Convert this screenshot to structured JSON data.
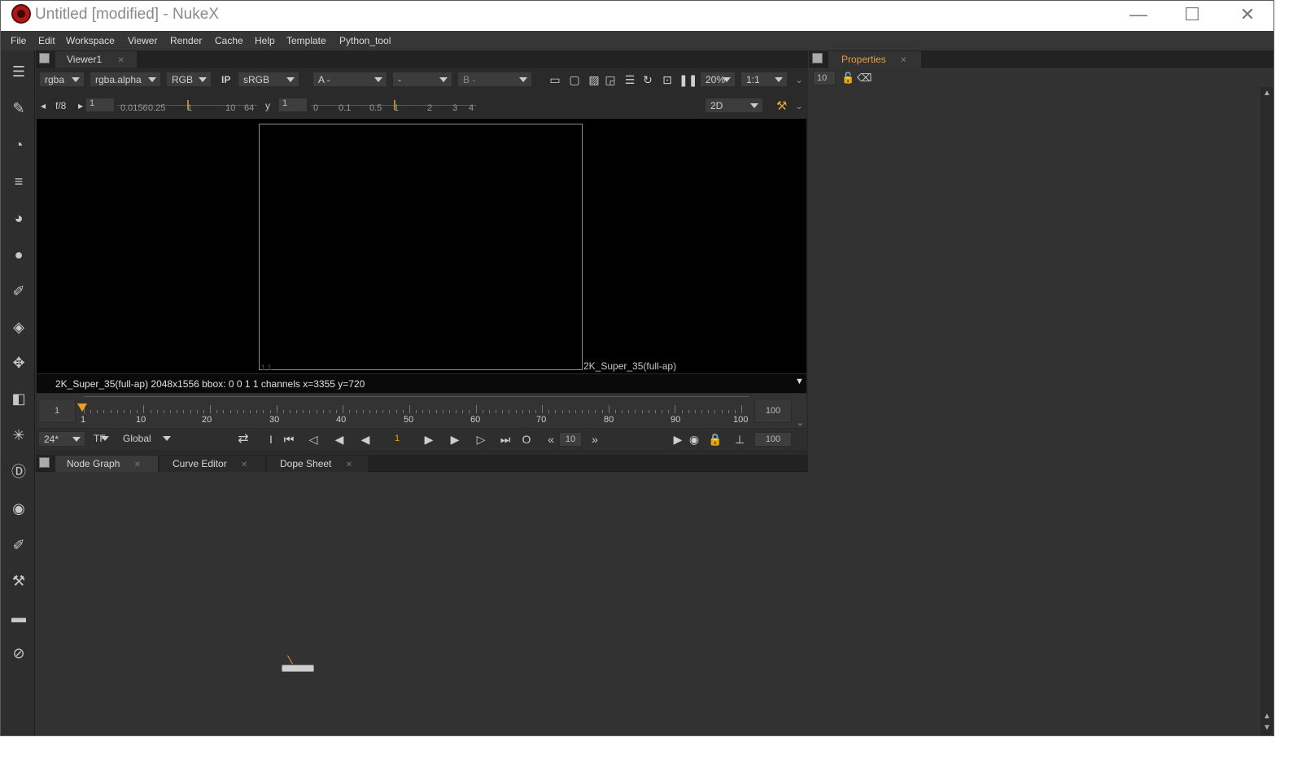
{
  "window": {
    "title": "Untitled [modified] - NukeX",
    "minimize": "—",
    "maximize": "☐",
    "close": "✕"
  },
  "menu": [
    "File",
    "Edit",
    "Workspace",
    "Viewer",
    "Render",
    "Cache",
    "Help",
    "Template",
    "Python_tool"
  ],
  "left_tools": [
    "read-icon",
    "paint-icon",
    "time-icon",
    "channel-icon",
    "color-icon",
    "filter-icon",
    "keyer-icon",
    "merge-icon",
    "transform-icon",
    "3d-icon",
    "particles-icon",
    "deep-icon",
    "views-icon",
    "metadata-icon",
    "toolsets-icon",
    "other-icon",
    "furnace-icon"
  ],
  "viewer": {
    "tab": "Viewer1",
    "channels": "rgba",
    "alpha": "rgba.alpha",
    "display": "RGB",
    "ip": "IP",
    "lut": "sRGB",
    "input_a": "A  -",
    "input_mid": "-",
    "input_b": "B  -",
    "zoom": "20%",
    "ratio": "1:1",
    "fstop": "f/8",
    "gain_value": "1",
    "gain_ticks": [
      "0.0156",
      "0.25",
      "1",
      "10",
      "64"
    ],
    "gamma_label": "y",
    "gamma_value": "1",
    "gamma_ticks": [
      "0",
      "0.1",
      "0.5",
      "1",
      "2",
      "3",
      "4"
    ],
    "mode": "2D",
    "corner_label": "1,1",
    "format_label": "2K_Super_35(full-ap)",
    "info": "2K_Super_35(full-ap) 2048x1556  bbox: 0 0 1 1 channels  x=3355 y=720"
  },
  "timeline": {
    "start": "1",
    "end": "100",
    "current": "1",
    "ticks": [
      "1",
      "10",
      "20",
      "30",
      "40",
      "50",
      "60",
      "70",
      "80",
      "90",
      "100"
    ],
    "fps": "24*",
    "tf": "TF",
    "global": "Global",
    "frame_field": "1",
    "step": "10",
    "end_field": "100"
  },
  "bottom_tabs": [
    "Node Graph",
    "Curve Editor",
    "Dope Sheet"
  ],
  "properties": {
    "tab": "Properties",
    "max_panels": "10"
  }
}
